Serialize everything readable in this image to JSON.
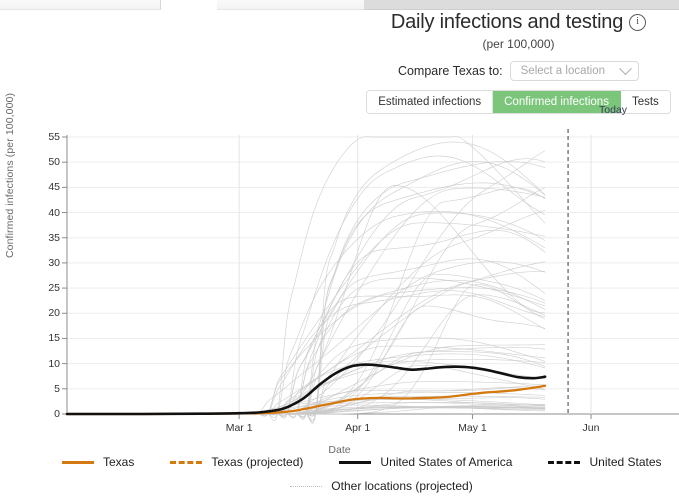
{
  "header": {
    "title": "Daily infections and testing",
    "info_icon": "info-circle-icon",
    "subtitle": "(per 100,000)",
    "compare_label": "Compare Texas to:",
    "select_placeholder": "Select a location",
    "chevron_icon": "chevron-down-icon",
    "tabs": [
      {
        "label": "Estimated infections",
        "active": false
      },
      {
        "label": "Confirmed infections",
        "active": true
      },
      {
        "label": "Tests",
        "active": false
      }
    ],
    "accent_green": "#7cc67c"
  },
  "legend": {
    "row1": [
      {
        "label": "Texas",
        "style": "solid",
        "color": "#d4790f"
      },
      {
        "label": "Texas (projected)",
        "style": "dashed",
        "color": "#d4790f"
      },
      {
        "label": "United States of America",
        "style": "solid",
        "color": "#111111"
      },
      {
        "label": "United States",
        "style": "dashed",
        "color": "#111111"
      }
    ],
    "row2": [
      {
        "label": "Other locations (projected)",
        "style": "dotted",
        "color": "#bdbdbd"
      }
    ]
  },
  "chart_data": {
    "type": "line",
    "title": "Daily infections and testing",
    "subtitle": "(per 100,000)",
    "xlabel": "Date",
    "ylabel": "Confirmed infections (per 100,000)",
    "ylim": [
      0,
      55
    ],
    "yticks": [
      0,
      5,
      10,
      15,
      20,
      25,
      30,
      35,
      40,
      45,
      50,
      55
    ],
    "xticks": [
      "Mar 1",
      "Apr 1",
      "May 1",
      "Jun"
    ],
    "grid": true,
    "legend_position": "bottom",
    "annotations": [
      {
        "label": "Today",
        "type": "vline",
        "x": "Today"
      }
    ],
    "x_domain_days": [
      0,
      160
    ],
    "x_tick_days": [
      45,
      76,
      106,
      137
    ],
    "today_day": 131,
    "data_end_day": 125,
    "series": [
      {
        "name": "Texas",
        "color": "#d4790f",
        "style": "solid",
        "x": [
          0,
          20,
          35,
          45,
          52,
          58,
          62,
          66,
          70,
          74,
          78,
          82,
          86,
          90,
          94,
          98,
          102,
          106,
          110,
          114,
          118,
          122,
          125
        ],
        "y": [
          0.0,
          0.0,
          0.05,
          0.1,
          0.2,
          0.5,
          1.0,
          1.6,
          2.2,
          2.8,
          3.1,
          3.2,
          3.1,
          3.1,
          3.2,
          3.3,
          3.6,
          4.0,
          4.3,
          4.5,
          4.8,
          5.2,
          5.6
        ]
      },
      {
        "name": "United States of America",
        "color": "#111111",
        "style": "solid",
        "x": [
          0,
          20,
          35,
          45,
          50,
          55,
          58,
          62,
          66,
          70,
          74,
          78,
          82,
          86,
          90,
          94,
          98,
          102,
          106,
          110,
          114,
          118,
          122,
          125
        ],
        "y": [
          0.0,
          0.0,
          0.05,
          0.15,
          0.3,
          0.8,
          1.5,
          3.2,
          5.8,
          8.0,
          9.4,
          9.8,
          9.6,
          9.2,
          8.8,
          9.0,
          9.3,
          9.4,
          9.2,
          8.7,
          8.0,
          7.3,
          7.1,
          7.4
        ]
      }
    ],
    "background_series_note": "Many faint gray lines for other locations; peak of highest ≈ 50 near Apr 10"
  }
}
